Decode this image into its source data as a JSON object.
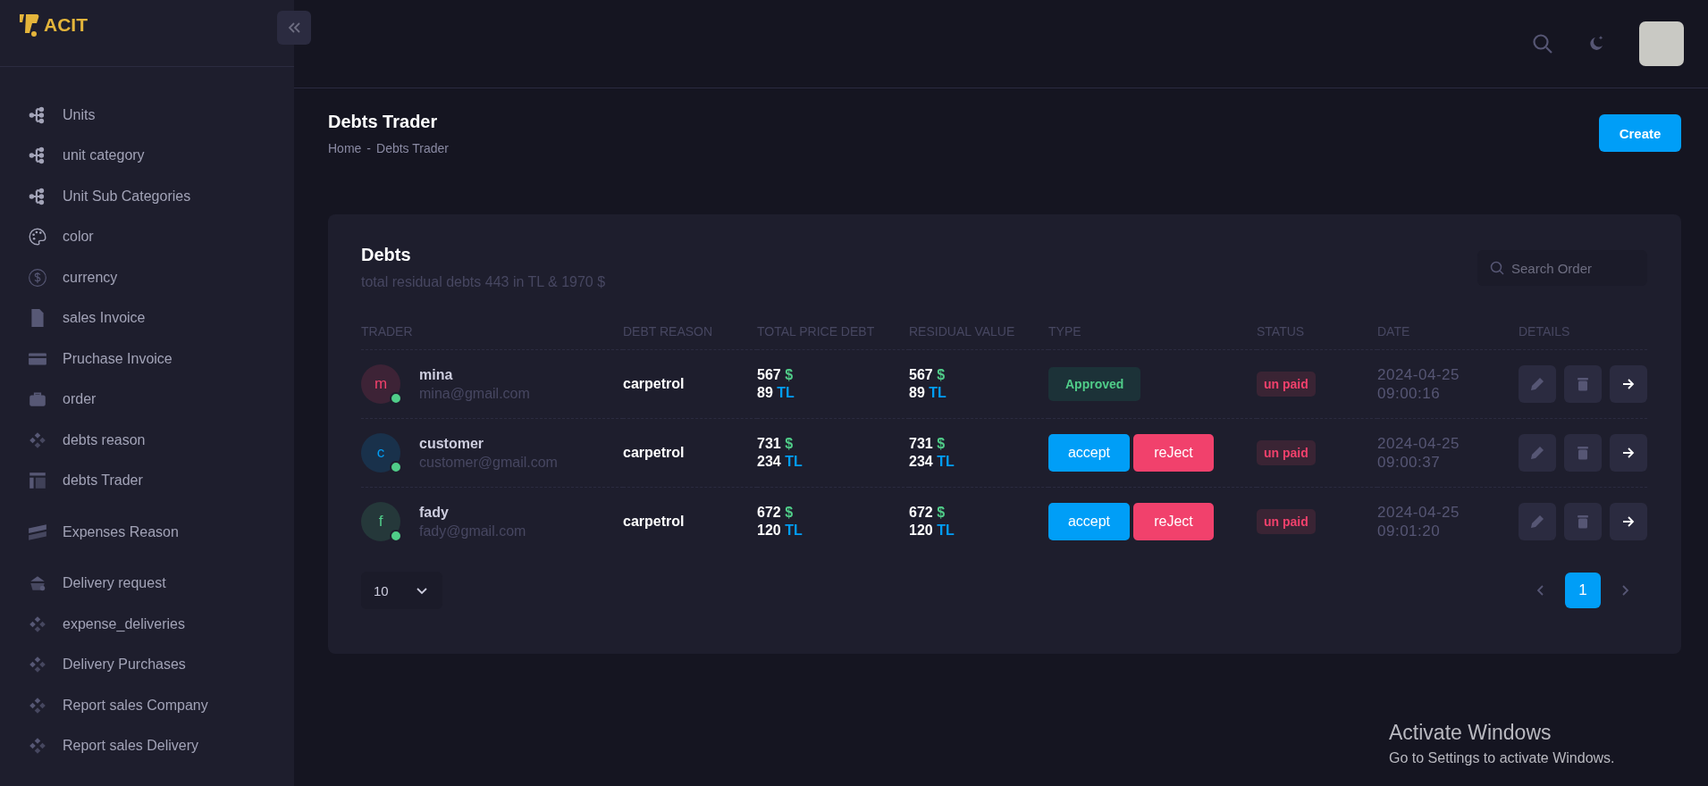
{
  "logo": {
    "text": "ACIT"
  },
  "sidebar": {
    "items": [
      {
        "label": "Units"
      },
      {
        "label": "unit category"
      },
      {
        "label": "Unit Sub Categories"
      },
      {
        "label": "color"
      },
      {
        "label": "currency"
      },
      {
        "label": "sales Invoice"
      },
      {
        "label": "Pruchase Invoice"
      },
      {
        "label": "order"
      },
      {
        "label": "debts reason"
      },
      {
        "label": "debts Trader"
      },
      {
        "label": "Expenses Reason"
      },
      {
        "label": "Delivery request"
      },
      {
        "label": "expense_deliveries"
      },
      {
        "label": "Delivery Purchases"
      },
      {
        "label": "Report sales Company"
      },
      {
        "label": "Report sales Delivery"
      }
    ]
  },
  "page": {
    "title": "Debts Trader",
    "breadcrumb": [
      "Home",
      "-",
      "Debts Trader"
    ],
    "create_button": "Create"
  },
  "card": {
    "title": "Debts",
    "subtitle": "total residual debts 443 in TL & 1970 $",
    "search": {
      "placeholder": "Search Order"
    },
    "columns": [
      "TRADER",
      "DEBT REASON",
      "TOTAL PRICE DEBT",
      "RESIDUAL VALUE",
      "TYPE",
      "STATUS",
      "DATE",
      "DETAILS"
    ],
    "rows": [
      {
        "initial": "m",
        "color": "#f1416c",
        "name": "mina",
        "email": "mina@gmail.com",
        "debt_reason": "carpetrol",
        "total": [
          {
            "amount": "567",
            "currency": "$"
          },
          {
            "amount": "89",
            "currency": "TL"
          }
        ],
        "residual": [
          {
            "amount": "567",
            "currency": "$"
          },
          {
            "amount": "89",
            "currency": "TL"
          }
        ],
        "type": {
          "kind": "badge",
          "label": "Approved"
        },
        "status": "un paid",
        "date": "2024-04-25 09:00:16"
      },
      {
        "initial": "c",
        "color": "#009ef7",
        "name": "customer",
        "email": "customer@gmail.com",
        "debt_reason": "carpetrol",
        "total": [
          {
            "amount": "731",
            "currency": "$"
          },
          {
            "amount": "234",
            "currency": "TL"
          }
        ],
        "residual": [
          {
            "amount": "731",
            "currency": "$"
          },
          {
            "amount": "234",
            "currency": "TL"
          }
        ],
        "type": {
          "kind": "actions",
          "buttons": [
            {
              "kind": "accept",
              "label": "accept"
            },
            {
              "kind": "reject",
              "label": "reJect"
            }
          ]
        },
        "status": "un paid",
        "date": "2024-04-25 09:00:37"
      },
      {
        "initial": "f",
        "color": "#50cd89",
        "name": "fady",
        "email": "fady@gmail.com",
        "debt_reason": "carpetrol",
        "total": [
          {
            "amount": "672",
            "currency": "$"
          },
          {
            "amount": "120",
            "currency": "TL"
          }
        ],
        "residual": [
          {
            "amount": "672",
            "currency": "$"
          },
          {
            "amount": "120",
            "currency": "TL"
          }
        ],
        "type": {
          "kind": "actions",
          "buttons": [
            {
              "kind": "accept",
              "label": "accept"
            },
            {
              "kind": "reject",
              "label": "reJect"
            }
          ]
        },
        "status": "un paid",
        "date": "2024-04-25 09:01:20"
      }
    ],
    "page_size": "10",
    "pages": [
      {
        "label": "1",
        "selected": true
      }
    ]
  },
  "os_notice": {
    "title": "Activate Windows",
    "text": "Go to Settings to activate Windows."
  }
}
